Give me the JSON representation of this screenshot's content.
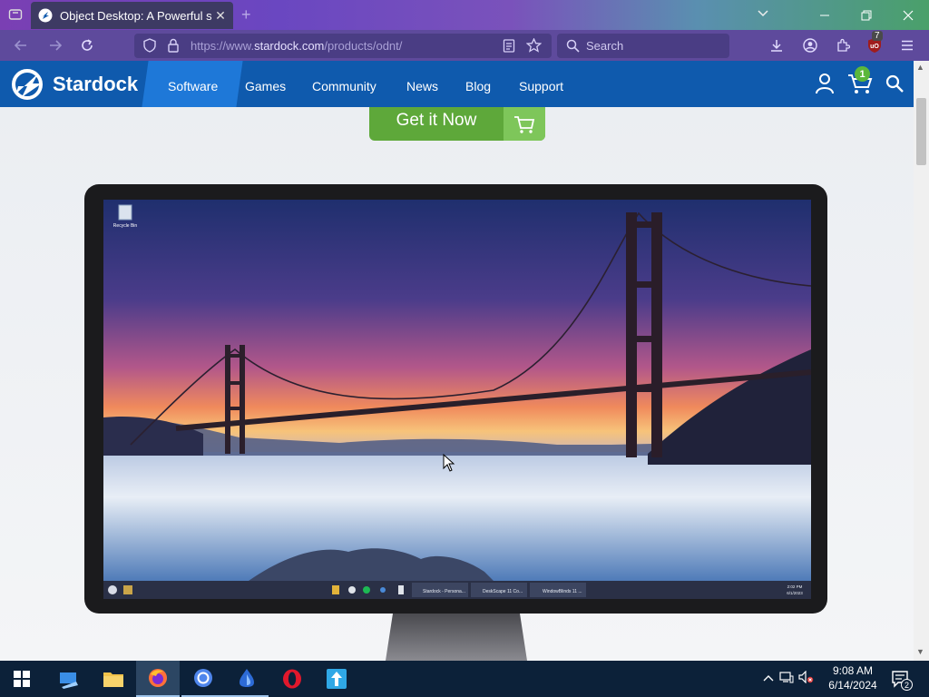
{
  "browser": {
    "tab_title": "Object Desktop: A Powerful suit",
    "new_tab_symbol": "+",
    "url_prefix": "https://www.",
    "url_domain": "stardock.com",
    "url_path": "/products/odnt/",
    "search_placeholder": "Search",
    "extension_badge": "7"
  },
  "site": {
    "logo_text": "Stardock",
    "nav": [
      "Software",
      "Games",
      "Community",
      "News",
      "Blog",
      "Support"
    ],
    "cart_count": "1",
    "cta_label": "Get it Now"
  },
  "screen": {
    "desktop_icon_label": "Recycle Bin",
    "taskbar_windows": [
      "Stardock - Persona...",
      "DeskScape 11 Co...",
      "WindowBlinds 11 ..."
    ],
    "clock_time": "2:02 PM",
    "clock_date": "6/1/2023"
  },
  "taskbar": {
    "time": "9:08 AM",
    "date": "6/14/2024",
    "notification_count": "2"
  },
  "colors": {
    "site_header": "#0f5aad",
    "nav_active": "#1e78d8",
    "cta_green": "#5ea83a",
    "taskbar": "#0c2139"
  }
}
